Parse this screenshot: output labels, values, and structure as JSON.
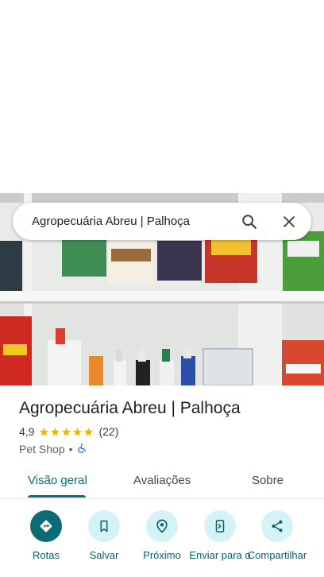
{
  "search": {
    "query": "Agropecuária Abreu | Palhoça"
  },
  "place": {
    "name": "Agropecuária Abreu | Palhoça",
    "rating": "4,9",
    "stars": 5,
    "review_count": "(22)",
    "category": "Pet Shop",
    "separator": "•",
    "wheelchair_icon": "wheelchair-accessible-icon"
  },
  "tabs": [
    {
      "label": "Visão geral",
      "active": true
    },
    {
      "label": "Avaliações",
      "active": false
    },
    {
      "label": "Sobre",
      "active": false
    }
  ],
  "actions": [
    {
      "label": "Rotas",
      "icon": "directions-icon"
    },
    {
      "label": "Salvar",
      "icon": "bookmark-icon"
    },
    {
      "label": "Próximo",
      "icon": "nearby-icon"
    },
    {
      "label": "Enviar para o",
      "icon": "send-to-phone-icon"
    },
    {
      "label": "Compartilhar",
      "icon": "share-icon"
    }
  ],
  "colors": {
    "accent": "#0d6b74",
    "action_bg": "#d4f3f7",
    "star": "#f5b400"
  }
}
